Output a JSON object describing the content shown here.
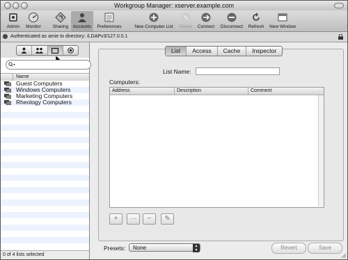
{
  "window": {
    "title": "Workgroup Manager: xserver.example.com"
  },
  "toolbar": {
    "items": [
      {
        "label": "Admin",
        "icon": "admin-icon"
      },
      {
        "label": "Monitor",
        "icon": "monitor-icon"
      },
      {
        "label": "Sharing",
        "icon": "sharing-icon"
      },
      {
        "label": "Accounts",
        "icon": "accounts-icon",
        "active": true
      },
      {
        "label": "Preferences",
        "icon": "preferences-icon"
      },
      {
        "label": "New Computer List",
        "icon": "add-icon"
      },
      {
        "label": "Delete",
        "icon": "delete-icon",
        "disabled": true
      },
      {
        "label": "Connect",
        "icon": "connect-icon"
      },
      {
        "label": "Disconnect",
        "icon": "disconnect-icon"
      },
      {
        "label": "Refresh",
        "icon": "refresh-icon"
      },
      {
        "label": "New Window",
        "icon": "new-window-icon"
      }
    ]
  },
  "auth": {
    "text": "Authenticated as amie to directory: /LDAPv3/127.0.0.1"
  },
  "sidebar": {
    "type_tabs": [
      "users-icon",
      "groups-icon",
      "computer-lists-icon",
      "workgroup-icon"
    ],
    "selected_type": 2,
    "search_placeholder": "",
    "column_header": "Name",
    "items": [
      {
        "label": "Guest Computers"
      },
      {
        "label": "Windows Computers"
      },
      {
        "label": "Marketing Computers"
      },
      {
        "label": "Rheology Computers"
      }
    ],
    "status": "0 of 4 lists selected"
  },
  "main": {
    "tabs": [
      "List",
      "Access",
      "Cache",
      "Inspector"
    ],
    "active_tab": "List",
    "list_name_label": "List Name:",
    "list_name_value": "",
    "computers_label": "Computers:",
    "columns": [
      "Address",
      "Description",
      "Comment"
    ],
    "table_buttons": [
      "+",
      "···",
      "−",
      "✎"
    ],
    "presets_label": "Presets:",
    "presets_value": "None",
    "revert_label": "Revert",
    "save_label": "Save"
  }
}
